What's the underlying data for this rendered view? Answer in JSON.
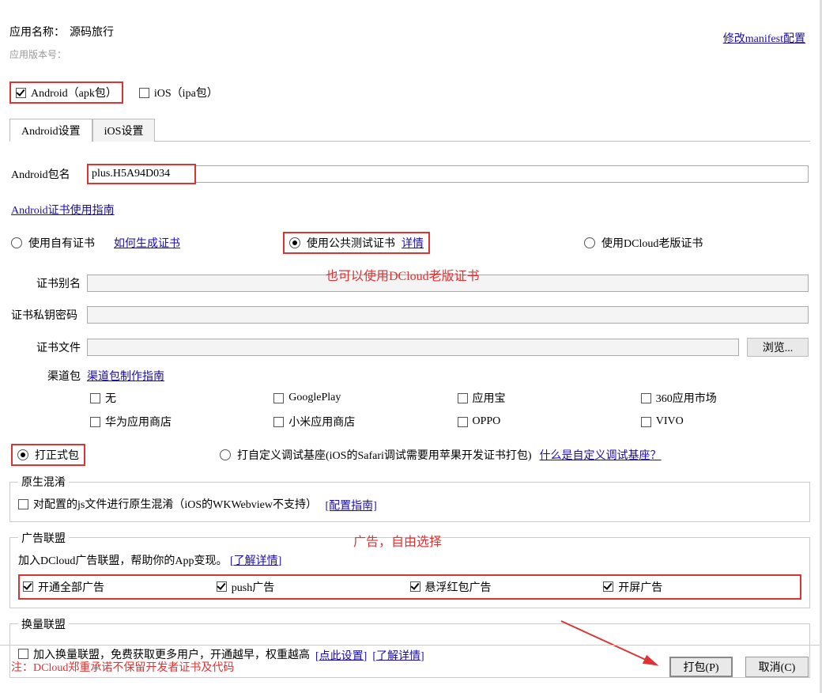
{
  "header": {
    "app_name_label": "应用名称：",
    "app_name_value": "源码旅行",
    "app_version_label": "应用版本号：",
    "manifest_link": "修改manifest配置"
  },
  "platforms": {
    "android_label": "Android（apk包）",
    "ios_label": "iOS（ipa包）"
  },
  "tabs": {
    "android": "Android设置",
    "ios": "iOS设置"
  },
  "android": {
    "package_label": "Android包名",
    "package_value": "plus.H5A94D034",
    "cert_guide_link": "Android证书使用指南",
    "cert_options": {
      "own": "使用自有证书",
      "own_link": "如何生成证书",
      "public": "使用公共测试证书",
      "public_link": "详情",
      "dcloud": "使用DCloud老版证书"
    },
    "cert_alias_label": "证书别名",
    "cert_key_label": "证书私钥密码",
    "cert_file_label": "证书文件",
    "browse_btn": "浏览...",
    "channel_label": "渠道包",
    "channel_guide_link": "渠道包制作指南",
    "channels": {
      "none": "无",
      "googleplay": "GooglePlay",
      "yyb": "应用宝",
      "360": "360应用市场",
      "huawei": "华为应用商店",
      "xiaomi": "小米应用商店",
      "oppo": "OPPO",
      "vivo": "VIVO"
    },
    "build_official": "打正式包",
    "build_custom": "打自定义调试基座(iOS的Safari调试需要用苹果开发证书打包)",
    "build_custom_link": "什么是自定义调试基座？"
  },
  "annotations": {
    "cert_hint": "也可以使用DCloud老版证书",
    "ad_hint": "广告，自由选择"
  },
  "native_mixed": {
    "legend": "原生混淆",
    "label": "对配置的js文件进行原生混淆（iOS的WKWebview不支持）",
    "link": "[配置指南]"
  },
  "ads": {
    "legend": "广告联盟",
    "desc": "加入DCloud广告联盟，帮助你的App变现。",
    "desc_link": "[了解详情]",
    "all": "开通全部广告",
    "push": "push广告",
    "float": "悬浮红包广告",
    "splash": "开屏广告"
  },
  "exchange": {
    "legend": "换量联盟",
    "desc": "加入换量联盟，免费获取更多用户，开通越早，权重越高",
    "link1": "[点此设置]",
    "link2": "[了解详情]"
  },
  "footer": {
    "note": "注：DCloud郑重承诺不保留开发者证书及代码",
    "build_btn": "打包(P)",
    "cancel_btn": "取消(C)"
  }
}
